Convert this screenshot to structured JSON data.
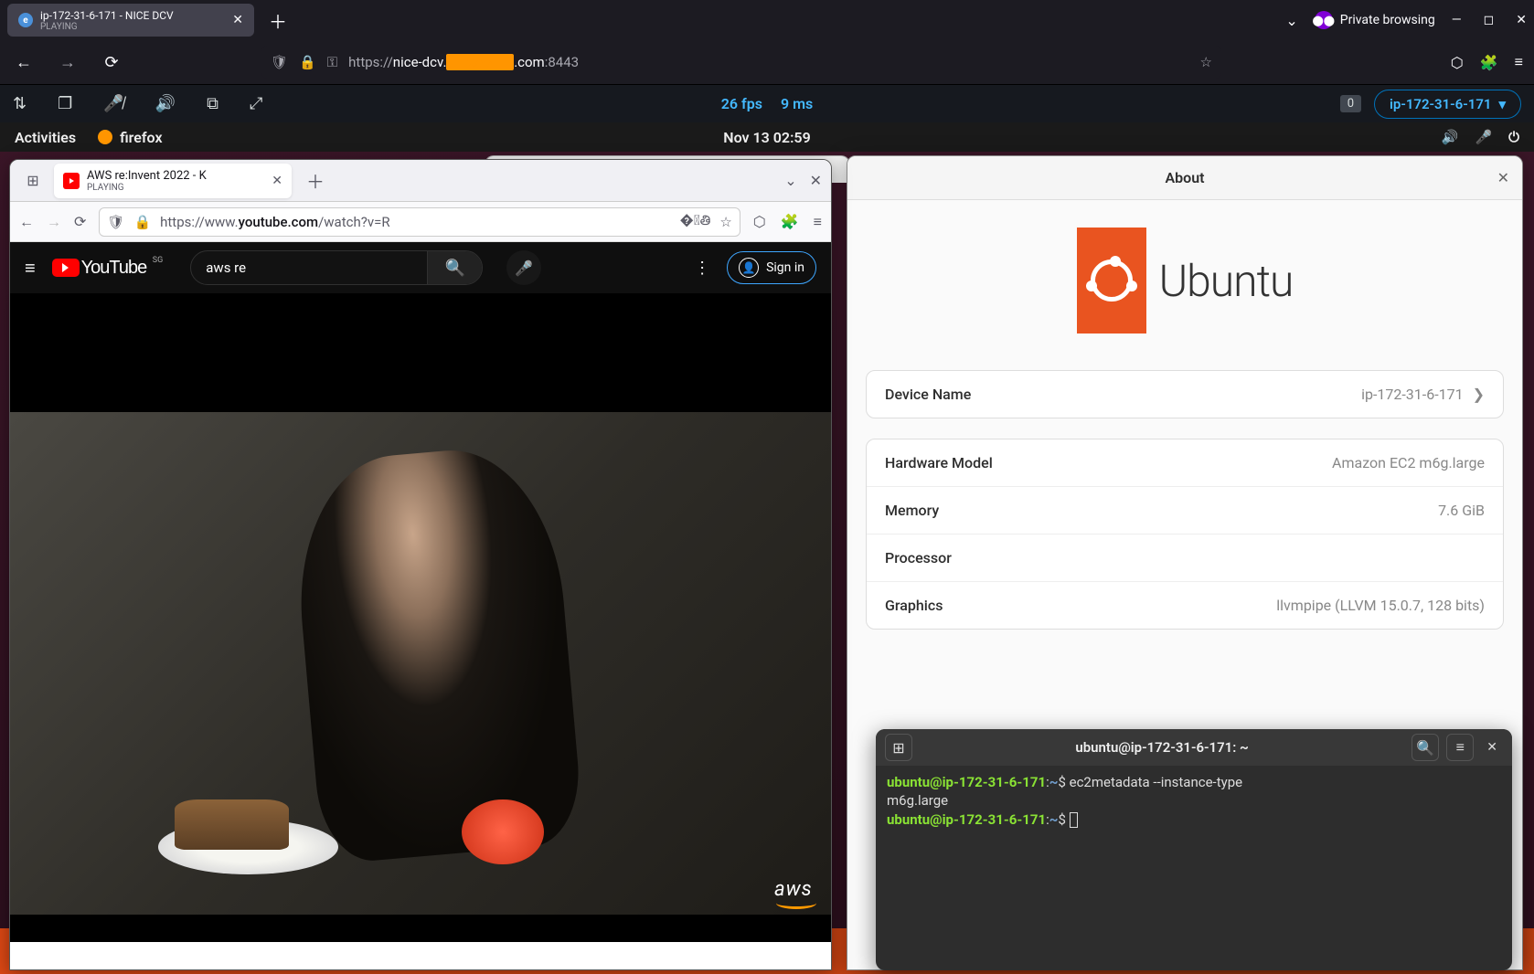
{
  "outer_firefox": {
    "tab": {
      "title": "ip-172-31-6-171 - NICE DCV",
      "sub": "PLAYING"
    },
    "private_label": "Private browsing",
    "url": {
      "prefix": "https://",
      "host_pre": "nice-dcv.",
      "host_post": ".com",
      "port": ":8443"
    }
  },
  "dcv": {
    "fps": "26 fps",
    "latency": "9 ms",
    "badge": "0",
    "host": "ip-172-31-6-171"
  },
  "gnome": {
    "activities": "Activities",
    "app": "firefox",
    "clock": "Nov 13  02:59"
  },
  "inner_firefox": {
    "tab": {
      "title": "AWS re:Invent 2022 - K",
      "sub": "PLAYING"
    },
    "url": {
      "prefix": "https://www.",
      "host": "youtube.com",
      "path": "/watch?v=R"
    }
  },
  "youtube": {
    "logo_text": "YouTube",
    "country": "SG",
    "search_value": "aws re",
    "signin": "Sign in",
    "watermark": "aws"
  },
  "about": {
    "title": "About",
    "brand": "Ubuntu",
    "device_name_label": "Device Name",
    "device_name_value": "ip-172-31-6-171",
    "hardware_label": "Hardware Model",
    "hardware_value": "Amazon EC2 m6g.large",
    "memory_label": "Memory",
    "memory_value": "7.6 GiB",
    "processor_label": "Processor",
    "graphics_label": "Graphics",
    "graphics_value": "llvmpipe (LLVM 15.0.7, 128 bits)"
  },
  "terminal": {
    "title": "ubuntu@ip-172-31-6-171: ~",
    "prompt_user": "ubuntu@ip-172-31-6-171",
    "prompt_path": "~",
    "cmd": "ec2metadata  --instance-type",
    "output": "m6g.large"
  }
}
